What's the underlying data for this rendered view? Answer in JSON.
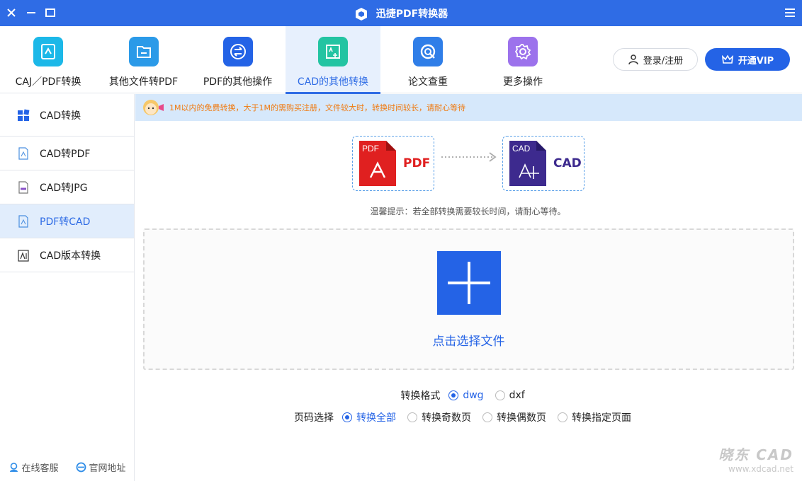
{
  "titlebar": {
    "title": "迅捷PDF转换器"
  },
  "toolbar": {
    "tabs": [
      {
        "label": "CAJ／PDF转换"
      },
      {
        "label": "其他文件转PDF"
      },
      {
        "label": "PDF的其他操作"
      },
      {
        "label": "CAD的其他转换"
      },
      {
        "label": "论文查重"
      },
      {
        "label": "更多操作"
      }
    ],
    "active_tab": "CAD的其他转换",
    "login_label": "登录/注册",
    "vip_label": "开通VIP"
  },
  "sidebar": {
    "items": [
      {
        "label": "CAD转换"
      },
      {
        "label": "CAD转PDF"
      },
      {
        "label": "CAD转JPG"
      },
      {
        "label": "PDF转CAD"
      },
      {
        "label": "CAD版本转换"
      }
    ],
    "active_item": "PDF转CAD",
    "footer": {
      "service_label": "在线客服",
      "site_label": "官网地址"
    }
  },
  "notice": {
    "text": "1M以内的免费转换，大于1M的需购买注册，文件较大时，转换时间较长，请耐心等待"
  },
  "conversion": {
    "from_badge": "PDF",
    "from_label": "PDF",
    "to_badge": "CAD",
    "to_label": "CAD",
    "tip": "温馨提示：若全部转换需要较长时间，请耐心等待。"
  },
  "dropzone": {
    "label": "点击选择文件"
  },
  "options": {
    "format_label": "转换格式",
    "formats": [
      {
        "label": "dwg",
        "selected": true
      },
      {
        "label": "dxf",
        "selected": false
      }
    ],
    "page_label": "页码选择",
    "pages": [
      {
        "label": "转换全部",
        "selected": true
      },
      {
        "label": "转换奇数页",
        "selected": false
      },
      {
        "label": "转换偶数页",
        "selected": false
      },
      {
        "label": "转换指定页面",
        "selected": false
      }
    ]
  },
  "watermark": {
    "line1": "晓东 CAD",
    "line2": "www.xdcad.net"
  },
  "colors": {
    "accent": "#2463e6",
    "titlebar": "#2f6ce5",
    "notice_text": "#f07a10",
    "notice_bg": "#d6e8fb"
  }
}
